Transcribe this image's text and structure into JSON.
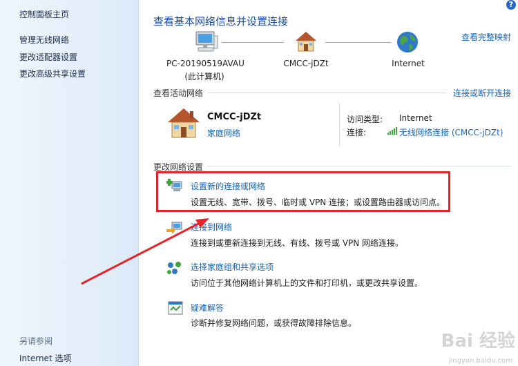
{
  "sidebar": {
    "home": "控制面板主页",
    "items": [
      "管理无线网络",
      "更改适配器设置",
      "更改高级共享设置"
    ],
    "see_also_heading": "另请参阅",
    "see_also_items": [
      "Internet 选项"
    ]
  },
  "header": {
    "title": "查看基本网络信息并设置连接",
    "full_map_link": "查看完整映射",
    "help_icon_glyph": "?"
  },
  "network_map": {
    "nodes": [
      {
        "label_line1": "PC-20190519AVAU",
        "label_line2": "(此计算机)",
        "icon": "computer-icon"
      },
      {
        "label_line1": "CMCC-jDZt",
        "label_line2": "",
        "icon": "house-icon"
      },
      {
        "label_line1": "Internet",
        "label_line2": "",
        "icon": "globe-icon"
      }
    ]
  },
  "active_networks": {
    "heading": "查看活动网络",
    "connect_disconnect_link": "连接或断开连接",
    "network_name": "CMCC-jDZt",
    "network_type_link": "家庭网络",
    "access_type_label": "访问类型:",
    "access_type_value": "Internet",
    "connection_label": "连接:",
    "connection_value": "无线网络连接 (CMCC-jDZt)"
  },
  "change_settings": {
    "heading": "更改网络设置",
    "tasks": [
      {
        "title": "设置新的连接或网络",
        "desc": "设置无线、宽带、拨号、临时或 VPN 连接；或设置路由器或访问点。",
        "icon": "new-connection-icon"
      },
      {
        "title": "连接到网络",
        "desc": "连接到或重新连接到无线、有线、拨号或 VPN 网络连接。",
        "icon": "connect-network-icon"
      },
      {
        "title": "选择家庭组和共享选项",
        "desc": "访问位于其他网络计算机上的文件和打印机，或更改共享设置。",
        "icon": "homegroup-icon"
      },
      {
        "title": "疑难解答",
        "desc": "诊断并修复网络问题，或获得故障排除信息。",
        "icon": "troubleshoot-icon"
      }
    ]
  },
  "watermark": {
    "text": "Bai 经验",
    "sub": "jingyan.baidu.com"
  },
  "colors": {
    "accent_link": "#1565c0",
    "title_blue": "#1e4c9a",
    "highlight_red": "#e2242a",
    "sidebar_bg": "#e3eefa"
  }
}
